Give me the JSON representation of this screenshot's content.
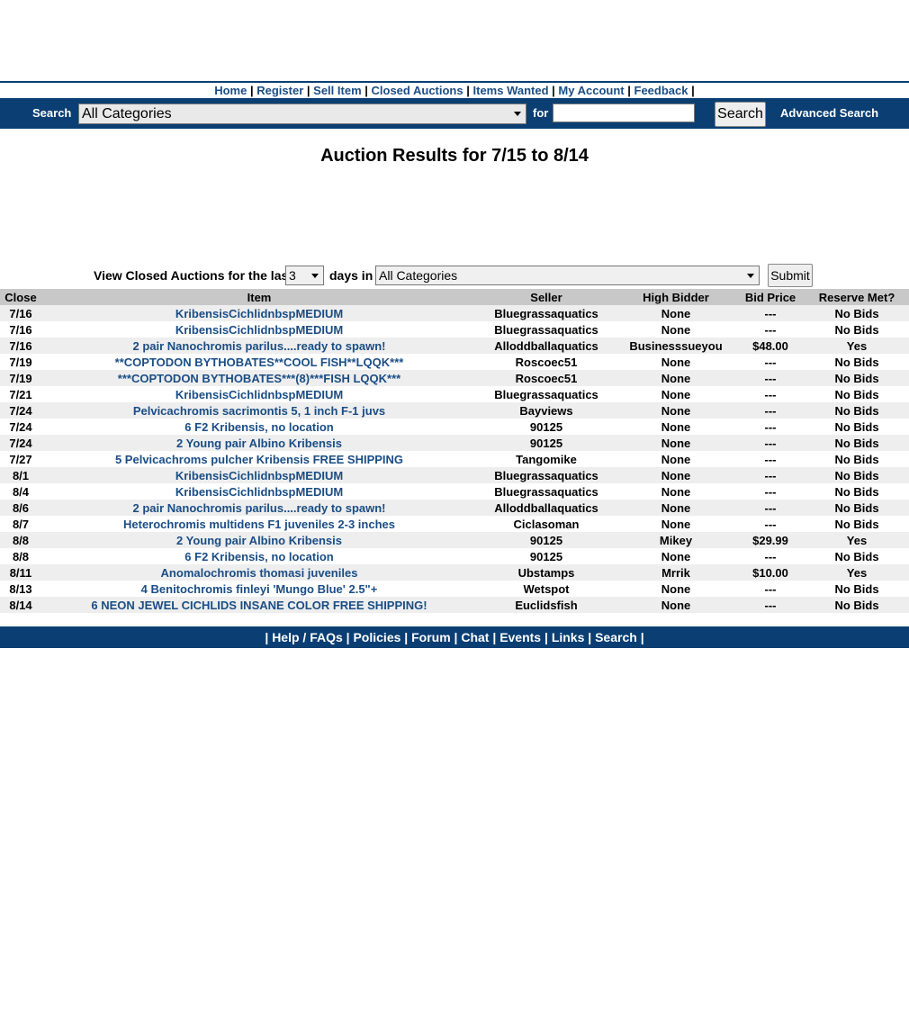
{
  "nav": {
    "items": [
      {
        "label": "Home"
      },
      {
        "label": "Register"
      },
      {
        "label": "Sell Item"
      },
      {
        "label": "Closed Auctions"
      },
      {
        "label": "Items Wanted"
      },
      {
        "label": "My Account"
      },
      {
        "label": "Feedback"
      }
    ],
    "separator": "|"
  },
  "search": {
    "label": "Search",
    "category": "All Categories",
    "for_label": "for",
    "query": "",
    "button": "Search",
    "advanced": "Advanced Search"
  },
  "title": "Auction Results for 7/15 to 8/14",
  "filter": {
    "label_prefix": "View Closed Auctions for the last",
    "days": "3",
    "label_mid": "days in",
    "category": "All Categories",
    "submit": "Submit"
  },
  "table": {
    "headers": [
      "Close",
      "Item",
      "Seller",
      "High Bidder",
      "Bid Price",
      "Reserve Met?"
    ],
    "rows": [
      {
        "close": "7/16",
        "item": "KribensisCichlidnbspMEDIUM",
        "seller": "Bluegrassaquatics",
        "bidder": "None",
        "price": "---",
        "reserve": "No Bids"
      },
      {
        "close": "7/16",
        "item": "KribensisCichlidnbspMEDIUM",
        "seller": "Bluegrassaquatics",
        "bidder": "None",
        "price": "---",
        "reserve": "No Bids"
      },
      {
        "close": "7/16",
        "item": "2 pair Nanochromis parilus....ready to spawn!",
        "seller": "Alloddballaquatics",
        "bidder": "Businesssueyou",
        "price": "$48.00",
        "reserve": "Yes"
      },
      {
        "close": "7/19",
        "item": "**COPTODON BYTHOBATES**COOL FISH**LQQK***",
        "seller": "Roscoec51",
        "bidder": "None",
        "price": "---",
        "reserve": "No Bids"
      },
      {
        "close": "7/19",
        "item": "***COPTODON BYTHOBATES***(8)***FISH LQQK***",
        "seller": "Roscoec51",
        "bidder": "None",
        "price": "---",
        "reserve": "No Bids"
      },
      {
        "close": "7/21",
        "item": "KribensisCichlidnbspMEDIUM",
        "seller": "Bluegrassaquatics",
        "bidder": "None",
        "price": "---",
        "reserve": "No Bids"
      },
      {
        "close": "7/24",
        "item": "Pelvicachromis sacrimontis 5, 1 inch F-1 juvs",
        "seller": "Bayviews",
        "bidder": "None",
        "price": "---",
        "reserve": "No Bids"
      },
      {
        "close": "7/24",
        "item": "6 F2 Kribensis, no location",
        "seller": "90125",
        "bidder": "None",
        "price": "---",
        "reserve": "No Bids"
      },
      {
        "close": "7/24",
        "item": "2 Young pair Albino Kribensis",
        "seller": "90125",
        "bidder": "None",
        "price": "---",
        "reserve": "No Bids"
      },
      {
        "close": "7/27",
        "item": "5 Pelvicachroms pulcher Kribensis FREE SHIPPING",
        "seller": "Tangomike",
        "bidder": "None",
        "price": "---",
        "reserve": "No Bids"
      },
      {
        "close": "8/1",
        "item": "KribensisCichlidnbspMEDIUM",
        "seller": "Bluegrassaquatics",
        "bidder": "None",
        "price": "---",
        "reserve": "No Bids"
      },
      {
        "close": "8/4",
        "item": "KribensisCichlidnbspMEDIUM",
        "seller": "Bluegrassaquatics",
        "bidder": "None",
        "price": "---",
        "reserve": "No Bids"
      },
      {
        "close": "8/6",
        "item": "2 pair Nanochromis parilus....ready to spawn!",
        "seller": "Alloddballaquatics",
        "bidder": "None",
        "price": "---",
        "reserve": "No Bids"
      },
      {
        "close": "8/7",
        "item": "Heterochromis multidens F1 juveniles 2-3 inches",
        "seller": "Ciclasoman",
        "bidder": "None",
        "price": "---",
        "reserve": "No Bids"
      },
      {
        "close": "8/8",
        "item": "2 Young pair Albino Kribensis",
        "seller": "90125",
        "bidder": "Mikey",
        "price": "$29.99",
        "reserve": "Yes"
      },
      {
        "close": "8/8",
        "item": "6 F2 Kribensis, no location",
        "seller": "90125",
        "bidder": "None",
        "price": "---",
        "reserve": "No Bids"
      },
      {
        "close": "8/11",
        "item": "Anomalochromis thomasi juveniles",
        "seller": "Ubstamps",
        "bidder": "Mrrik",
        "price": "$10.00",
        "reserve": "Yes"
      },
      {
        "close": "8/13",
        "item": "4 Benitochromis finleyi 'Mungo Blue' 2.5\"+",
        "seller": "Wetspot",
        "bidder": "None",
        "price": "---",
        "reserve": "No Bids"
      },
      {
        "close": "8/14",
        "item": "6 NEON JEWEL CICHLIDS INSANE COLOR FREE SHIPPING!",
        "seller": "Euclidsfish",
        "bidder": "None",
        "price": "---",
        "reserve": "No Bids"
      }
    ]
  },
  "footer": {
    "items": [
      {
        "label": "Help / FAQs"
      },
      {
        "label": "Policies"
      },
      {
        "label": "Forum"
      },
      {
        "label": "Chat"
      },
      {
        "label": "Events"
      },
      {
        "label": "Links"
      },
      {
        "label": "Search"
      }
    ],
    "separator": "|"
  },
  "colors": {
    "brand_blue": "#0b3f73",
    "link_blue": "#1a4d85",
    "header_gray": "#c8c8c8",
    "stripe_gray": "#eeeeee"
  }
}
